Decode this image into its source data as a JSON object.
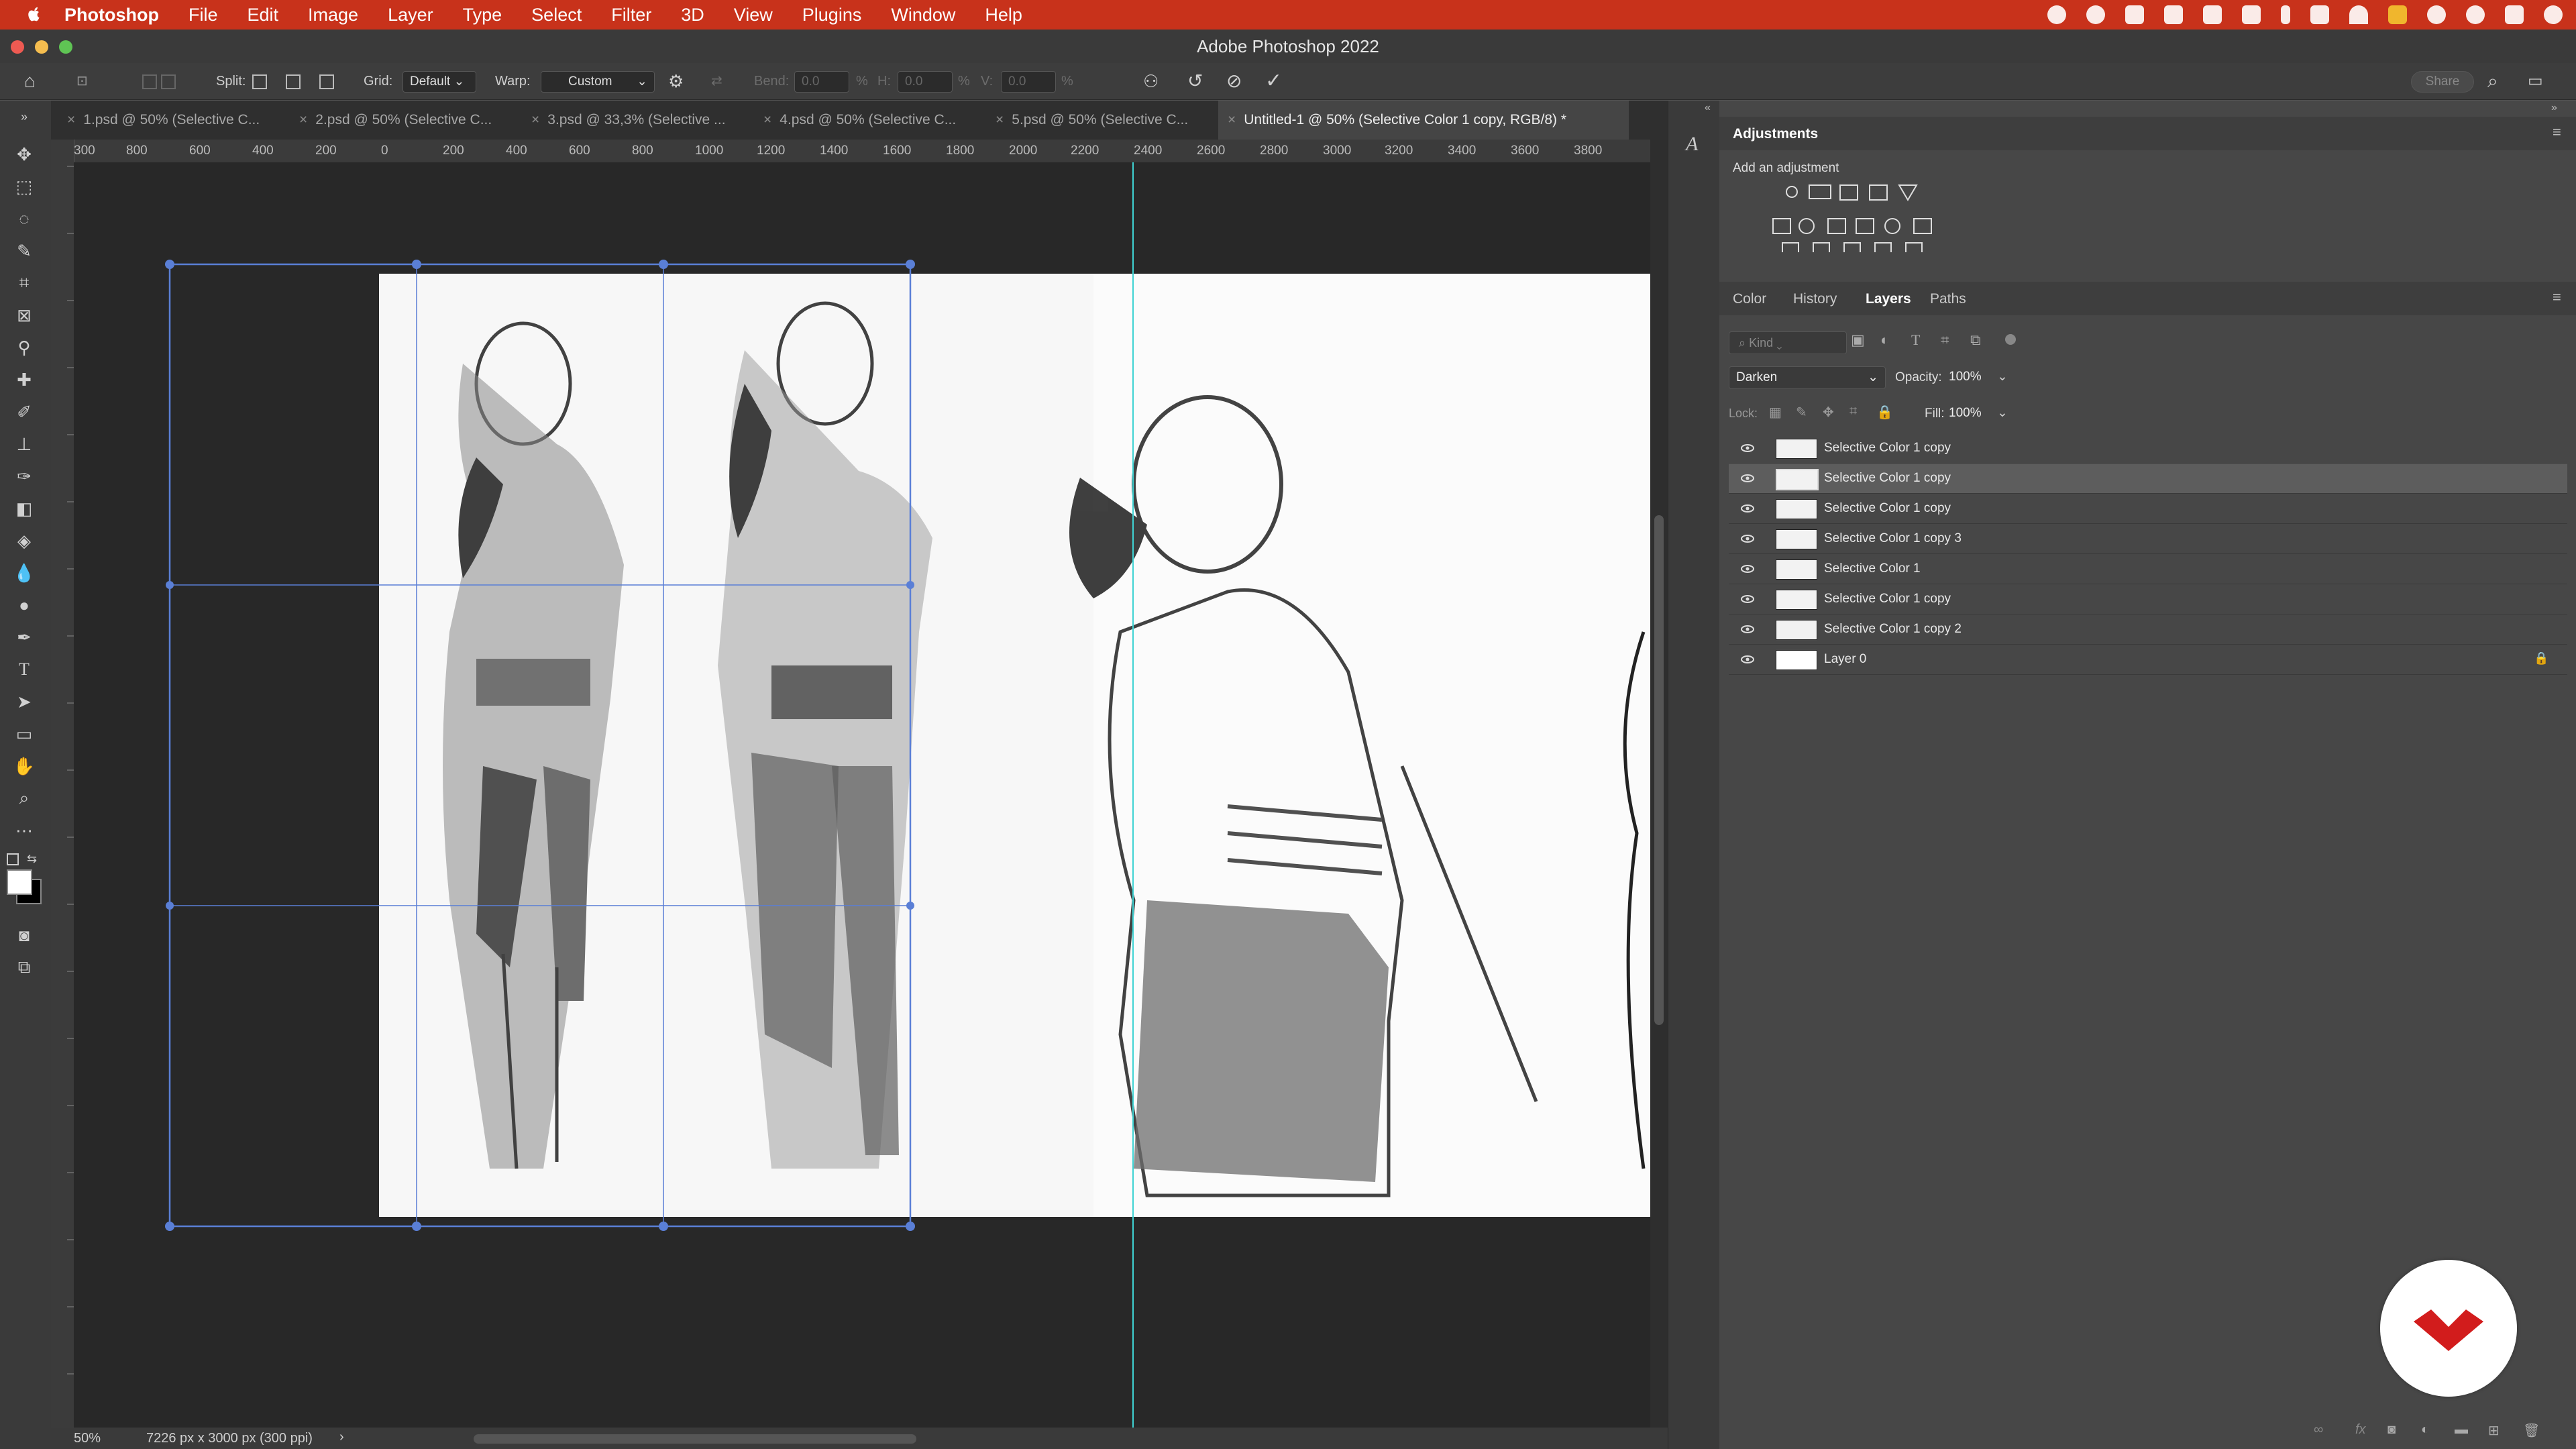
{
  "menubar": {
    "app_name": "Photoshop",
    "items": [
      "File",
      "Edit",
      "Image",
      "Layer",
      "Type",
      "Select",
      "Filter",
      "3D",
      "View",
      "Plugins",
      "Window",
      "Help"
    ],
    "bar_color": "#c8321b"
  },
  "window": {
    "title": "Adobe Photoshop 2022"
  },
  "options": {
    "split_label": "Split:",
    "grid_label": "Grid:",
    "grid_value": "Default",
    "warp_label": "Warp:",
    "warp_value": "Custom",
    "bend_label": "Bend:",
    "bend_value": "0.0",
    "h_label": "H:",
    "h_value": "0.0",
    "v_label": "V:",
    "v_value": "0.0",
    "percent": "%",
    "share_label": "Share"
  },
  "tabs": [
    {
      "label": "1.psd @ 50% (Selective C...",
      "active": false
    },
    {
      "label": "2.psd @ 50% (Selective C...",
      "active": false
    },
    {
      "label": "3.psd @ 33,3% (Selective ...",
      "active": false
    },
    {
      "label": "4.psd @ 50% (Selective C...",
      "active": false
    },
    {
      "label": "5.psd @ 50% (Selective C...",
      "active": false
    },
    {
      "label": "Untitled-1 @ 50% (Selective Color 1 copy, RGB/8) *",
      "active": true
    }
  ],
  "ruler_top": [
    "300",
    "800",
    "600",
    "400",
    "200",
    "0",
    "200",
    "400",
    "600",
    "800",
    "1000",
    "1200",
    "1400",
    "1600",
    "1800",
    "2000",
    "2200",
    "2400",
    "2600",
    "2800",
    "3000",
    "3200",
    "3400",
    "3600",
    "3800"
  ],
  "statusbar": {
    "zoom": "50%",
    "doc_info": "7226 px x 3000 px (300 ppi)",
    "arrow": "›"
  },
  "adjustments": {
    "title": "Adjustments",
    "subtitle": "Add an adjustment"
  },
  "layers_panel": {
    "tabs": [
      "Color",
      "History",
      "Layers",
      "Paths"
    ],
    "active_tab": "Layers",
    "kind_placeholder": "Kind",
    "blend_mode": "Darken",
    "opacity_label": "Opacity:",
    "opacity_value": "100%",
    "lock_label": "Lock:",
    "fill_label": "Fill:",
    "fill_value": "100%",
    "layers": [
      {
        "name": "Selective Color 1 copy",
        "selected": false
      },
      {
        "name": "Selective Color 1 copy",
        "selected": true
      },
      {
        "name": "Selective Color 1 copy",
        "selected": false
      },
      {
        "name": "Selective Color 1 copy 3",
        "selected": false
      },
      {
        "name": "Selective Color 1",
        "selected": false
      },
      {
        "name": "Selective Color 1 copy",
        "selected": false
      },
      {
        "name": "Selective Color 1 copy 2",
        "selected": false
      },
      {
        "name": "Layer 0",
        "selected": false,
        "locked": true
      }
    ]
  },
  "colors": {
    "accent_selection": "#5a7fd6",
    "guide": "#3fd3d3",
    "logo_red": "#d21c1c"
  }
}
